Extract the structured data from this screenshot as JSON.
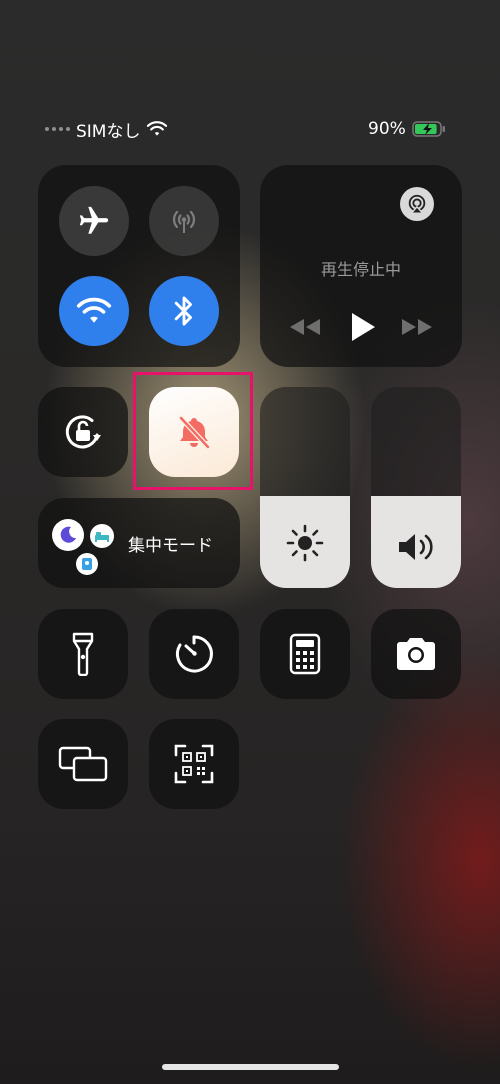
{
  "status_bar": {
    "carrier": "SIMなし",
    "battery_percent": "90%",
    "battery_level": 0.9,
    "charging": true
  },
  "media": {
    "status": "再生停止中"
  },
  "focus": {
    "label": "集中モード"
  },
  "sliders": {
    "brightness": 0.46,
    "volume": 0.46
  },
  "highlight_color": "#e5136a",
  "accent_color": "#2f80ed",
  "mute_icon_color": "#f26c64"
}
